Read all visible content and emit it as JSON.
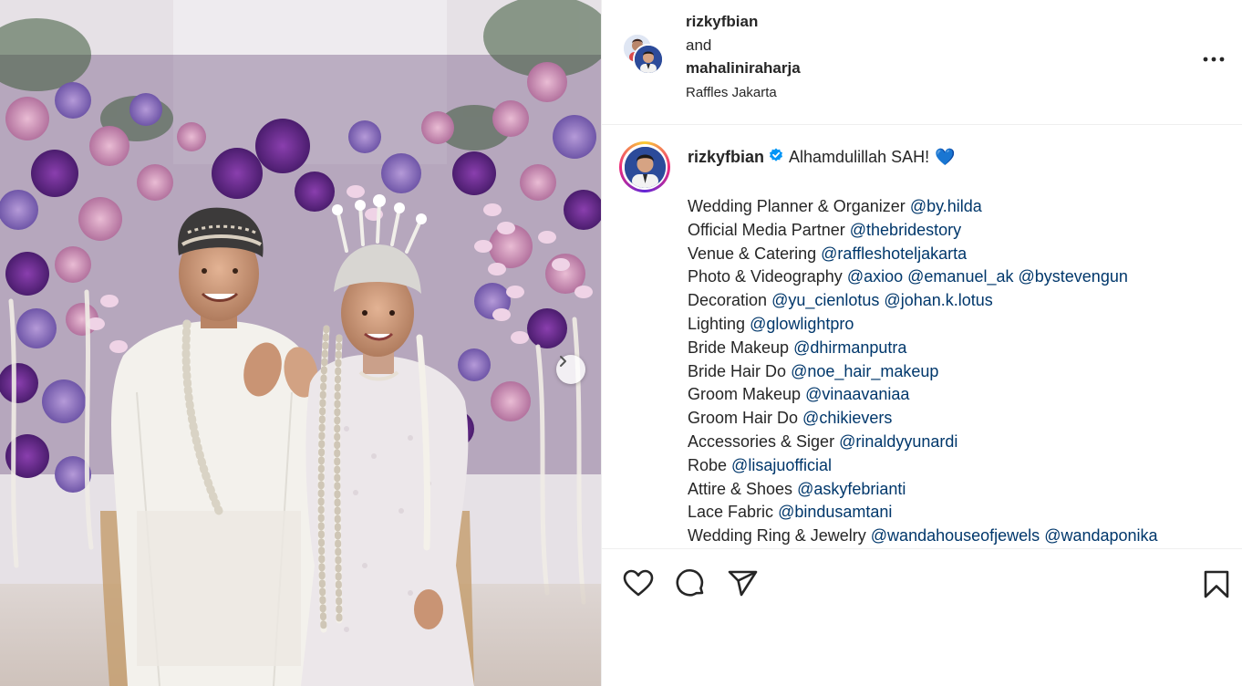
{
  "post": {
    "carousel_next_icon": "chevron-right-icon"
  },
  "header": {
    "user1": "rizkyfbian",
    "conjunction": "and",
    "user2": "mahaliniraharja",
    "location": "Raffles Jakarta",
    "more_icon": "more-horizontal-icon"
  },
  "caption": {
    "username": "rizkyfbian",
    "verified_icon": "verified-badge-icon",
    "text": "Alhamdulillah SAH!",
    "emoji": "💙",
    "credits": [
      {
        "role": "Wedding Planner & Organizer",
        "tags": [
          "@by.hilda"
        ]
      },
      {
        "role": "Official Media Partner",
        "tags": [
          "@thebridestory"
        ]
      },
      {
        "role": "Venue & Catering",
        "tags": [
          "@raffleshoteljakarta"
        ]
      },
      {
        "role": "Photo & Videography",
        "tags": [
          "@axioo",
          "@emanuel_ak",
          "@bystevengun"
        ]
      },
      {
        "role": "Decoration",
        "tags": [
          "@yu_cienlotus",
          "@johan.k.lotus"
        ]
      },
      {
        "role": "Lighting",
        "tags": [
          "@glowlightpro"
        ]
      },
      {
        "role": "Bride Makeup",
        "tags": [
          "@dhirmanputra"
        ]
      },
      {
        "role": "Bride Hair Do",
        "tags": [
          "@noe_hair_makeup"
        ]
      },
      {
        "role": "Groom Makeup",
        "tags": [
          "@vinaavaniaa"
        ]
      },
      {
        "role": "Groom Hair Do",
        "tags": [
          "@chikievers"
        ]
      },
      {
        "role": "Accessories & Siger",
        "tags": [
          "@rinaldyyunardi"
        ]
      },
      {
        "role": "Robe",
        "tags": [
          "@lisajuofficial"
        ]
      },
      {
        "role": "Attire & Shoes",
        "tags": [
          "@askyfebrianti"
        ]
      },
      {
        "role": "Lace Fabric",
        "tags": [
          "@bindusamtani"
        ]
      },
      {
        "role": "Wedding Ring & Jewelry",
        "tags": [
          "@wandahouseofjewels",
          "@wandaponika"
        ]
      }
    ]
  },
  "actions": {
    "like_icon": "heart-icon",
    "comment_icon": "comment-icon",
    "share_icon": "send-icon",
    "save_icon": "bookmark-icon"
  },
  "colors": {
    "text": "#262626",
    "mention": "#00376b",
    "verified": "#0095f6",
    "divider": "#efefef"
  }
}
